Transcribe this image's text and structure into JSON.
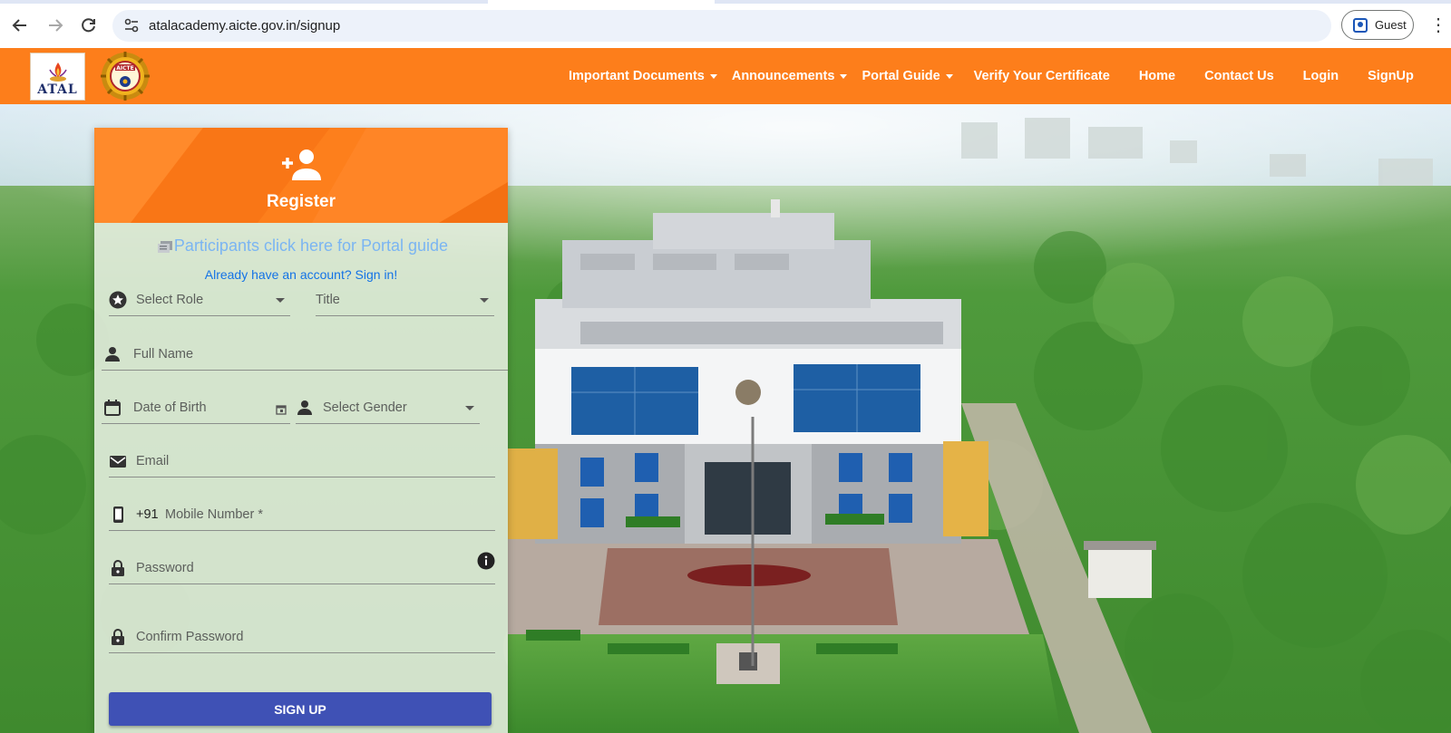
{
  "browser": {
    "url": "atalacademy.aicte.gov.in/signup",
    "profile_label": "Guest"
  },
  "site": {
    "logo_text": "ATAL",
    "aicte_logo_text": "AICTE",
    "nav": [
      {
        "label": "Important Documents",
        "has_dropdown": true
      },
      {
        "label": "Announcements",
        "has_dropdown": true
      },
      {
        "label": "Portal Guide",
        "has_dropdown": true
      },
      {
        "label": "Verify Your Certificate",
        "has_dropdown": false
      },
      {
        "label": "Home",
        "has_dropdown": false
      },
      {
        "label": "Contact Us",
        "has_dropdown": false
      },
      {
        "label": "Login",
        "has_dropdown": false
      },
      {
        "label": "SignUp",
        "has_dropdown": false
      }
    ],
    "colors": {
      "header": "#fd7e1b",
      "button": "#3f51b5",
      "link": "#1473e6"
    }
  },
  "register": {
    "title": "Register",
    "portal_guide_link": "Participants click here for Portal guide",
    "signin_link": "Already have an account? Sign in!",
    "fields": {
      "role": "Select Role",
      "title": "Title",
      "full_name": "Full Name",
      "dob": "Date of Birth",
      "gender": "Select Gender",
      "email": "Email",
      "country_code": "+91",
      "mobile": "Mobile Number *",
      "password": "Password",
      "confirm_password": "Confirm Password"
    },
    "submit_label": "SIGN UP"
  }
}
